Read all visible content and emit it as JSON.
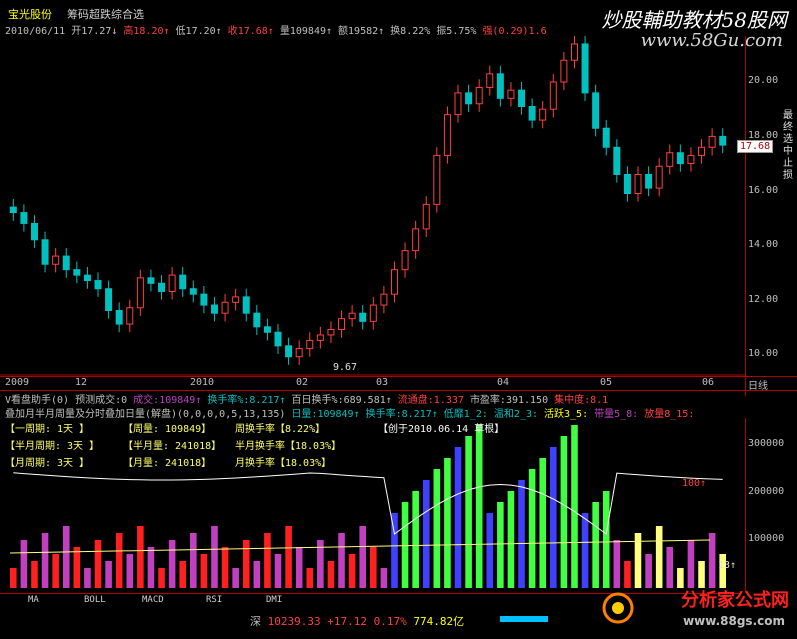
{
  "header": {
    "stock_name": "宝光股份",
    "formula_name": "筹码超跌综合选",
    "stats": [
      {
        "text": "2010/06/11",
        "color": "#c0c0c0"
      },
      {
        "text": "开17.27↓",
        "color": "#c0c0c0"
      },
      {
        "text": "高18.20↑",
        "color": "#ff4040"
      },
      {
        "text": "低17.20↑",
        "color": "#c0c0c0"
      },
      {
        "text": "收17.68↑",
        "color": "#ff4040"
      },
      {
        "text": "量109849↑",
        "color": "#c0c0c0"
      },
      {
        "text": "额19582↑",
        "color": "#c0c0c0"
      },
      {
        "text": "换8.22%",
        "color": "#c0c0c0"
      },
      {
        "text": "振5.75%",
        "color": "#c0c0c0"
      },
      {
        "text": "强(0.29)1.6",
        "color": "#ff4040"
      }
    ],
    "watermark_title": "炒股輔助教材58股网",
    "watermark_url": "www.58Gu.com"
  },
  "price_axis": {
    "labels": [
      "20.00",
      "18.00",
      "16.00",
      "14.00",
      "12.00",
      "10.00"
    ],
    "current_price": "17.68",
    "low_marker": "9.67",
    "side_labels": [
      "最",
      "终",
      "选",
      "中",
      "止",
      "损"
    ]
  },
  "time_axis": {
    "labels": [
      "2009",
      "12",
      "2010",
      "02",
      "03",
      "04",
      "05",
      "06"
    ],
    "period": "日线"
  },
  "info_rows": {
    "row1": [
      {
        "text": "V看盘助手(0)",
        "color": "#c0c0c0"
      },
      {
        "text": "预测成交:0",
        "color": "#c0c0c0"
      },
      {
        "text": "成交:109849↑",
        "color": "#c040c0"
      },
      {
        "text": "换手率%:8.217↑",
        "color": "#00c0c0"
      },
      {
        "text": "百日换手%:689.581↑",
        "color": "#c0c0c0"
      },
      {
        "text": "流通盘:1.337",
        "color": "#ff4040"
      },
      {
        "text": "市盈率:391.150",
        "color": "#c0c0c0"
      },
      {
        "text": "集中度:8.1",
        "color": "#ff4040"
      }
    ],
    "row2": [
      {
        "text": "叠加月半月周量及分时叠加日量(解盘)(0,0,0,0,5,13,135)",
        "color": "#c0c0c0"
      },
      {
        "text": "日量:109849↑",
        "color": "#00c0c0"
      },
      {
        "text": "换手率:8.217↑",
        "color": "#00c0c0"
      },
      {
        "text": "低靡1_2:",
        "color": "#00c0c0"
      },
      {
        "text": "温和2_3:",
        "color": "#00c0c0"
      },
      {
        "text": "活跃3_5:",
        "color": "#ffff00"
      },
      {
        "text": "带量5_8:",
        "color": "#c040c0"
      },
      {
        "text": "放量8_15:",
        "color": "#ff4040"
      }
    ]
  },
  "period_box": {
    "line1": [
      "【一周期: 1天 】",
      "【周量: 109849】",
      "周换手率【8.22%】"
    ],
    "line2": [
      "【半月周期: 3天 】",
      "【半月量: 241018】",
      "半月换手率【18.03%】"
    ],
    "line3": [
      "【月周期: 3天 】",
      "【月量: 241018】",
      "月换手率【18.03%】"
    ],
    "created": "【创于2010.06.14 草根】"
  },
  "volume_axis": {
    "labels": [
      "300000",
      "200000",
      "100000"
    ],
    "mark_100": "100↑",
    "mark_13": "13↑"
  },
  "tabs": [
    "MA",
    "BOLL",
    "MACD",
    "RSI",
    "DMI"
  ],
  "status_bar": {
    "market": "深",
    "index": "10239.33",
    "change": "+17.12",
    "pct": "0.17%",
    "amount": "774.82亿"
  },
  "logo": {
    "title": "分析家公式网",
    "url": "www.88gs.com"
  },
  "colors": {
    "up": "#ff4040",
    "down": "#00c0c0",
    "frame": "#b00000"
  },
  "chart_data": {
    "type": "candlestick",
    "title": "",
    "close_series_approx": [
      15.2,
      14.8,
      14.2,
      13.3,
      13.6,
      13.1,
      12.9,
      12.7,
      12.4,
      11.6,
      11.1,
      11.7,
      12.8,
      12.6,
      12.3,
      12.9,
      12.4,
      12.2,
      11.8,
      11.5,
      11.9,
      12.1,
      11.5,
      11.0,
      10.8,
      10.3,
      9.9,
      10.2,
      10.5,
      10.7,
      10.9,
      11.3,
      11.5,
      11.2,
      11.8,
      12.2,
      13.1,
      13.8,
      14.6,
      15.5,
      17.3,
      18.8,
      19.6,
      19.2,
      19.8,
      20.3,
      19.4,
      19.7,
      19.1,
      18.6,
      19.0,
      20.0,
      20.8,
      21.4,
      19.6,
      18.3,
      17.6,
      16.6,
      15.9,
      16.6,
      16.1,
      16.9,
      17.4,
      17.0,
      17.3,
      17.6,
      18.0,
      17.68
    ],
    "volume_axis_ticks": [
      100000,
      200000,
      300000
    ]
  }
}
